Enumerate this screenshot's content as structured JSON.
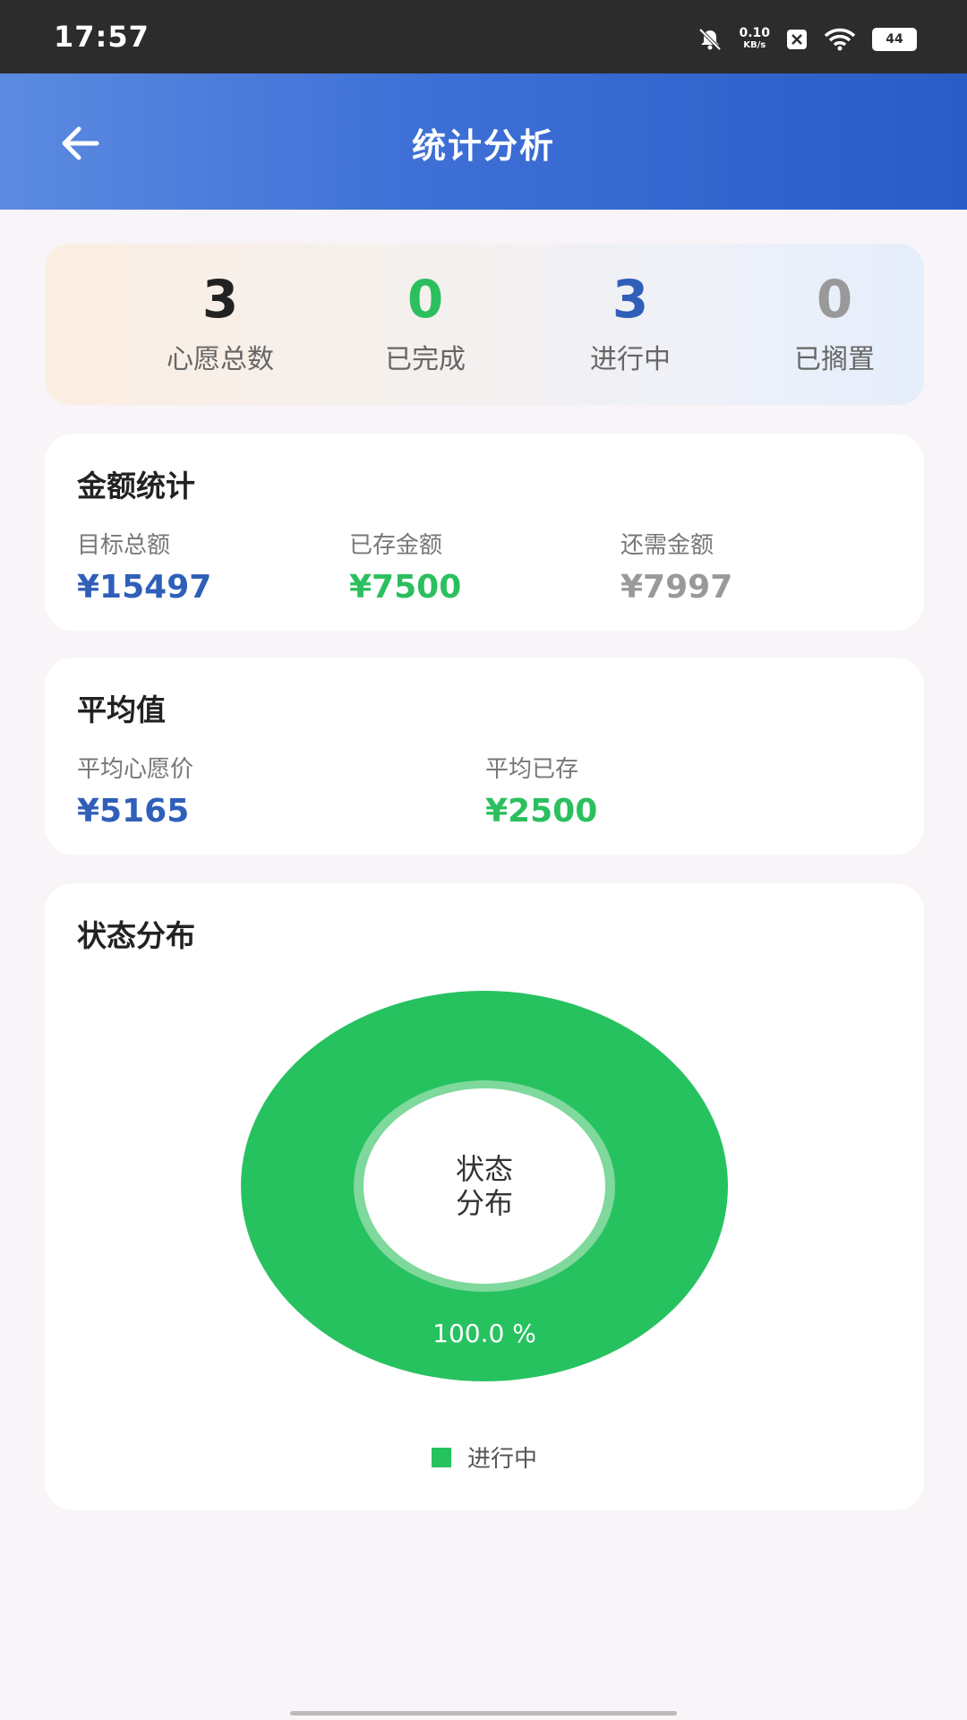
{
  "status_bar": {
    "time": "17:57",
    "net_speed_value": "0.10",
    "net_speed_unit": "KB/s",
    "battery": "44",
    "icons": [
      "mute-bell-icon",
      "notification-icon",
      "wifi-icon",
      "battery-icon"
    ]
  },
  "header": {
    "title": "统计分析",
    "back_icon": "arrow-left-icon"
  },
  "summary": [
    {
      "value": "3",
      "label": "心愿总数",
      "color": "#222222"
    },
    {
      "value": "0",
      "label": "已完成",
      "color": "#2bbf5e"
    },
    {
      "value": "3",
      "label": "进行中",
      "color": "#2f5fb8"
    },
    {
      "value": "0",
      "label": "已搁置",
      "color": "#999999"
    }
  ],
  "amount_stats": {
    "title": "金额统计",
    "fields": [
      {
        "label": "目标总额",
        "value": "¥15497",
        "color": "#2f5fb8"
      },
      {
        "label": "已存金额",
        "value": "¥7500",
        "color": "#2bbf5e"
      },
      {
        "label": "还需金额",
        "value": "¥7997",
        "color": "#999999"
      }
    ]
  },
  "averages": {
    "title": "平均值",
    "fields": [
      {
        "label": "平均心愿价",
        "value": "¥5165",
        "color": "#2f5fb8"
      },
      {
        "label": "平均已存",
        "value": "¥2500",
        "color": "#2bbf5e"
      }
    ]
  },
  "status_chart": {
    "title": "状态分布",
    "center_line1": "状态",
    "center_line2": "分布",
    "slice_label": "100.0 %",
    "legend_label": "进行中",
    "color": "#27c260"
  },
  "chart_data": {
    "type": "pie",
    "categories": [
      "进行中"
    ],
    "values": [
      100.0
    ],
    "title": "状态分布",
    "labels": [
      "100.0 %"
    ]
  }
}
